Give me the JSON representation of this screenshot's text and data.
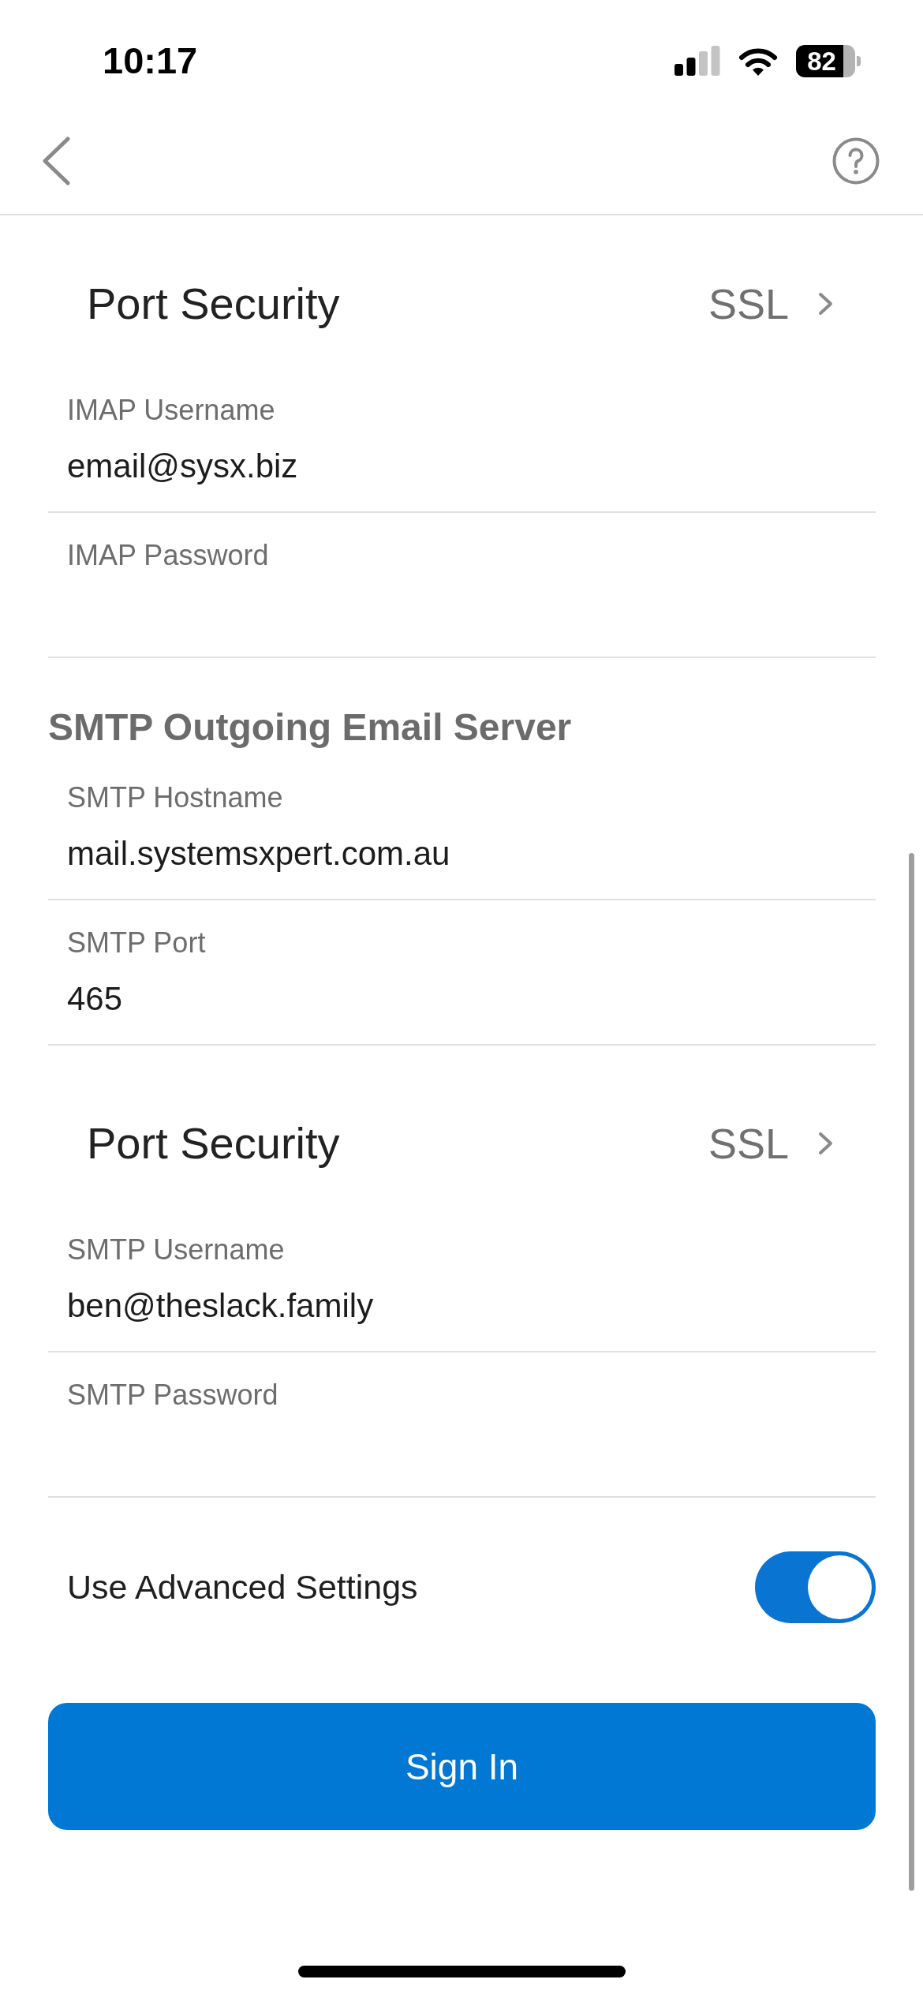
{
  "status_bar": {
    "time": "10:17",
    "battery": "82"
  },
  "form": [
    {
      "kind": "picker",
      "label": "Port Security",
      "value": "SSL"
    },
    {
      "kind": "field",
      "label": "IMAP Username",
      "value": "email@sysx.biz"
    },
    {
      "kind": "field",
      "label": "IMAP Password"
    },
    {
      "kind": "heading",
      "text": "SMTP Outgoing Email Server"
    },
    {
      "kind": "field",
      "label": "SMTP Hostname",
      "value": "mail.systemsxpert.com.au"
    },
    {
      "kind": "field",
      "label": "SMTP Port",
      "value": "465"
    },
    {
      "kind": "picker",
      "label": "Port Security",
      "value": "SSL"
    },
    {
      "kind": "field",
      "label": "SMTP Username",
      "value": "ben@theslack.family"
    },
    {
      "kind": "field",
      "label": "SMTP Password"
    },
    {
      "kind": "toggle",
      "label": "Use Advanced Settings",
      "on": true
    }
  ],
  "sign_in_button": "Sign In"
}
